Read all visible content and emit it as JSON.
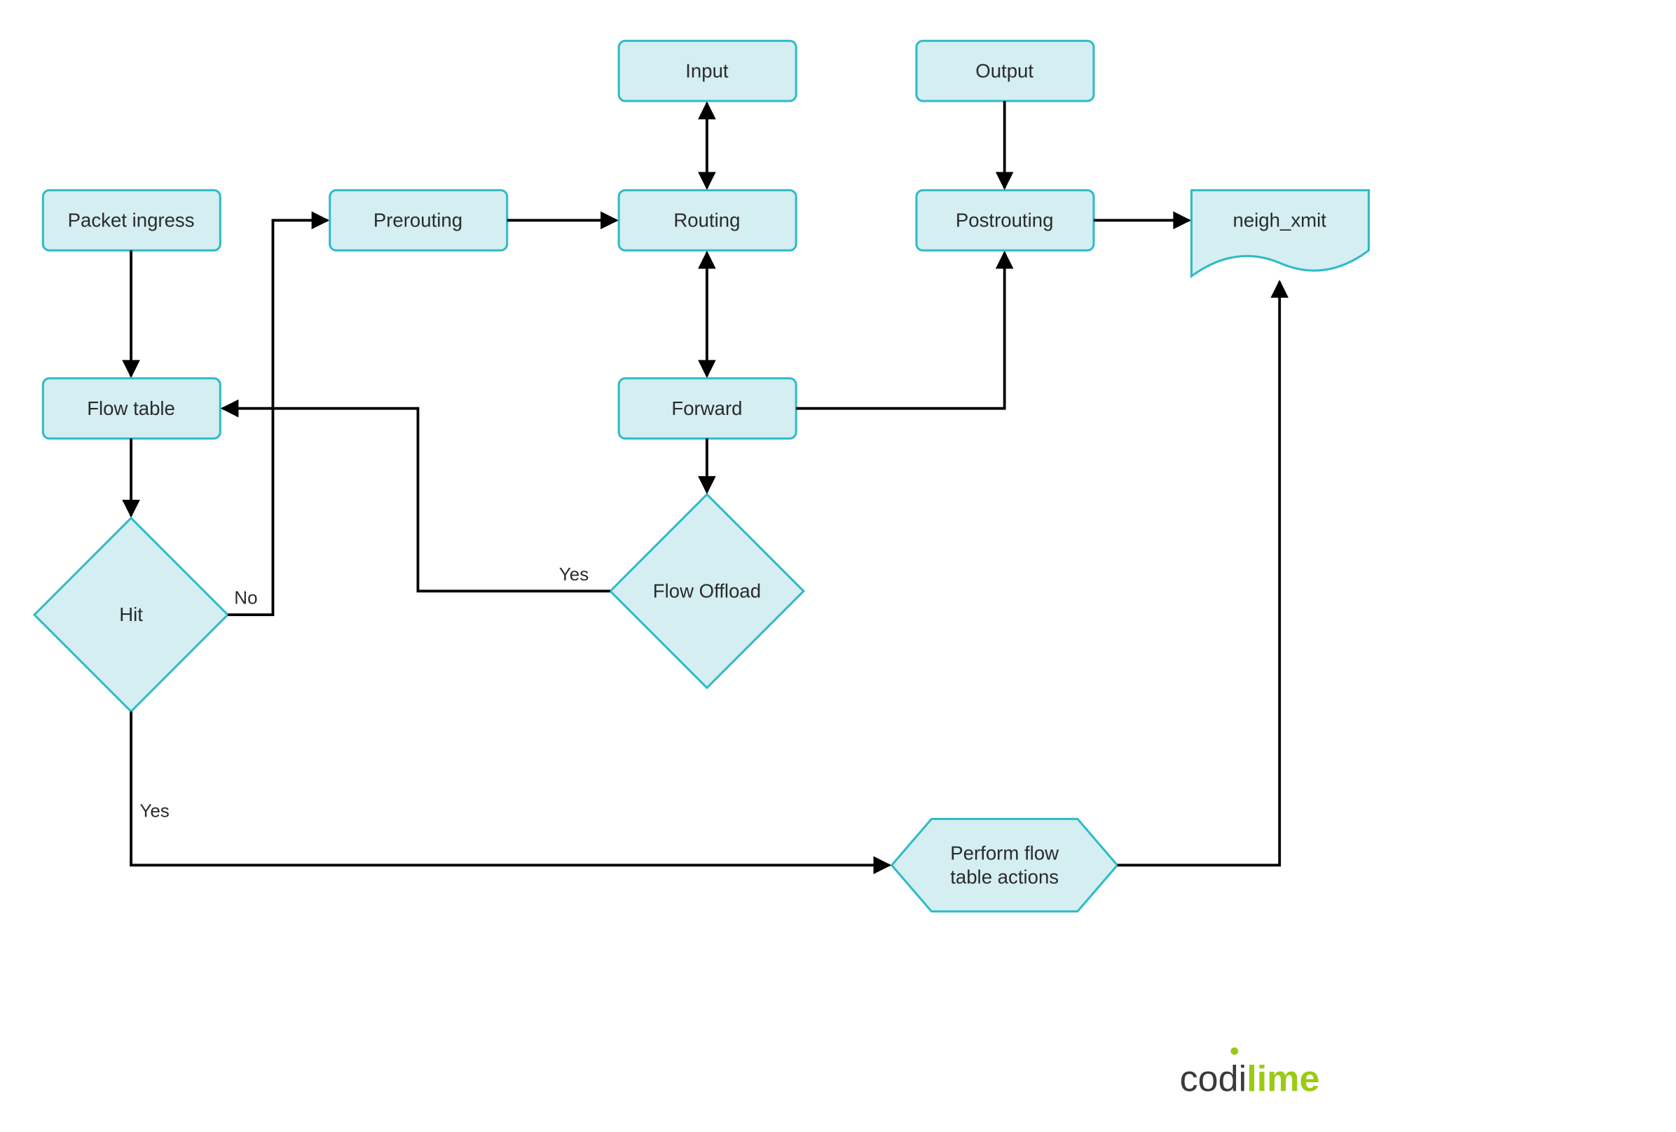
{
  "nodes": {
    "packet_ingress": "Packet ingress",
    "flow_table": "Flow table",
    "hit": "Hit",
    "prerouting": "Prerouting",
    "routing": "Routing",
    "input": "Input",
    "forward": "Forward",
    "flow_offload": "Flow Offload",
    "output": "Output",
    "postrouting": "Postrouting",
    "neigh_xmit": "neigh_xmit",
    "perform_actions_l1": "Perform flow",
    "perform_actions_l2": "table actions"
  },
  "edge_labels": {
    "hit_no": "No",
    "hit_yes": "Yes",
    "offload_yes": "Yes"
  },
  "logo": {
    "part1": "codi",
    "part2": "lime"
  }
}
